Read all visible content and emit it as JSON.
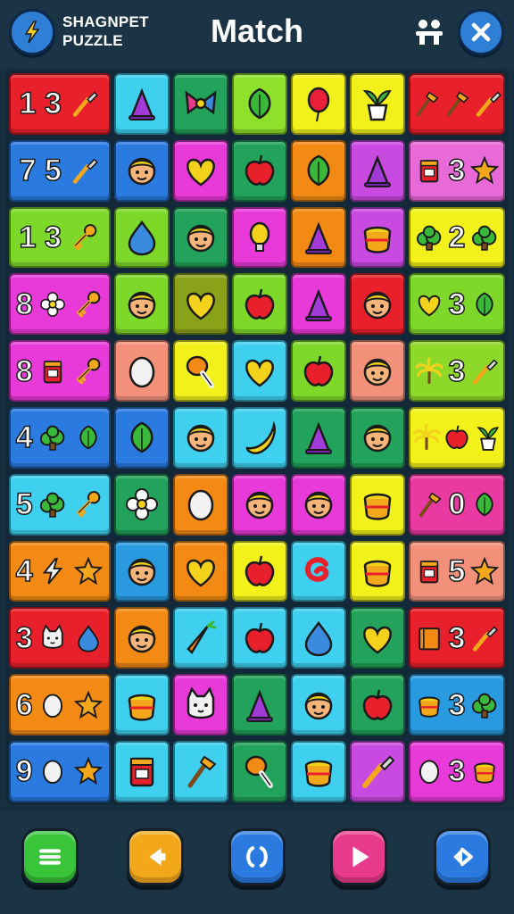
{
  "header": {
    "brand_line1": "SHAGNPET",
    "brand_line2": "PUZZLE",
    "title": "Match",
    "logo_icon": "lightning-emblem-icon",
    "people_icon": "people-icon",
    "close_icon": "close-icon"
  },
  "board": {
    "rows": [
      {
        "color": "#e8202c",
        "stack": [
          "1",
          "3"
        ],
        "stack_icons": [
          "brush-icon"
        ],
        "cells": [
          {
            "color": "#3fd0f0",
            "icon": "cone-icon"
          },
          {
            "color": "#22a25a",
            "icon": "bow-icon"
          },
          {
            "color": "#8ee02a",
            "icon": "leaf-icon"
          },
          {
            "color": "#f2f21a",
            "icon": "balloon-icon"
          },
          {
            "color": "#f2f21a",
            "icon": "plant-icon"
          }
        ],
        "last": {
          "color": "#e8202c",
          "icons": [
            "tools-icon",
            "tools-icon",
            "brush-icon"
          ]
        }
      },
      {
        "color": "#2a7ae0",
        "stack": [
          "7",
          "5"
        ],
        "stack_icons": [
          "brush-icon"
        ],
        "cells": [
          {
            "color": "#2a7ae0",
            "icon": "face-icon"
          },
          {
            "color": "#e83ad8",
            "icon": "heart-icon"
          },
          {
            "color": "#22a25a",
            "icon": "apple-icon"
          },
          {
            "color": "#f28a14",
            "icon": "leaf-icon"
          },
          {
            "color": "#c84ae0",
            "icon": "cone-icon"
          }
        ],
        "last": {
          "color": "#e86ad8",
          "num": "3",
          "icons": [
            "jar-icon",
            "star-icon"
          ]
        }
      },
      {
        "color": "#7ed82a",
        "stack": [
          "1",
          "3"
        ],
        "stack_icons": [
          "key-icon"
        ],
        "cells": [
          {
            "color": "#7ed82a",
            "icon": "drop-icon"
          },
          {
            "color": "#22a25a",
            "icon": "face-icon"
          },
          {
            "color": "#e83ad8",
            "icon": "bulb-icon"
          },
          {
            "color": "#f28a14",
            "icon": "cone-icon"
          },
          {
            "color": "#c84ae0",
            "icon": "pot-icon"
          }
        ],
        "last": {
          "color": "#f2f21a",
          "num": "2",
          "icons": [
            "bush-icon",
            "bush-icon"
          ]
        }
      },
      {
        "color": "#e83ad8",
        "stack": [
          "8"
        ],
        "stack_icons": [
          "flower-icon",
          "key-icon"
        ],
        "cells": [
          {
            "color": "#7ed82a",
            "icon": "face-icon"
          },
          {
            "color": "#8aa21a",
            "icon": "heart-icon"
          },
          {
            "color": "#7ed82a",
            "icon": "apple-icon"
          },
          {
            "color": "#e83ad8",
            "icon": "cone-icon"
          },
          {
            "color": "#e8202c",
            "icon": "face-icon"
          }
        ],
        "last": {
          "color": "#7ed82a",
          "num": "3",
          "icons": [
            "heart-icon",
            "leaf-icon"
          ]
        }
      },
      {
        "color": "#e83ad8",
        "stack": [
          "8"
        ],
        "stack_icons": [
          "jar-icon",
          "key-icon"
        ],
        "cells": [
          {
            "color": "#f2907a",
            "icon": "egg-icon"
          },
          {
            "color": "#f2f21a",
            "icon": "drumstick-icon"
          },
          {
            "color": "#3fd0f0",
            "icon": "heart-icon"
          },
          {
            "color": "#7ed82a",
            "icon": "apple-icon"
          },
          {
            "color": "#f2907a",
            "icon": "face-icon"
          }
        ],
        "last": {
          "color": "#8ed82a",
          "num": "3",
          "icons": [
            "palm-icon",
            "brush-icon"
          ]
        }
      },
      {
        "color": "#2a7ae0",
        "stack": [
          "4"
        ],
        "stack_icons": [
          "bush-icon",
          "leaf-icon"
        ],
        "cells": [
          {
            "color": "#2a7ae0",
            "icon": "leaf-icon"
          },
          {
            "color": "#3fd0f0",
            "icon": "face-icon"
          },
          {
            "color": "#3fd0f0",
            "icon": "banana-icon"
          },
          {
            "color": "#22a25a",
            "icon": "cone-icon"
          },
          {
            "color": "#22a25a",
            "icon": "face-icon"
          }
        ],
        "last": {
          "color": "#f2f21a",
          "icons": [
            "palm-icon",
            "apple-icon",
            "plant-icon"
          ]
        }
      },
      {
        "color": "#3fd0f0",
        "stack": [
          "5"
        ],
        "stack_icons": [
          "bush-icon",
          "key-icon"
        ],
        "cells": [
          {
            "color": "#22a25a",
            "icon": "flower-icon"
          },
          {
            "color": "#f28a14",
            "icon": "egg-icon"
          },
          {
            "color": "#e83ad8",
            "icon": "face-icon"
          },
          {
            "color": "#e83ad8",
            "icon": "face-icon"
          },
          {
            "color": "#f2f21a",
            "icon": "pot-icon"
          }
        ],
        "last": {
          "color": "#e83aa0",
          "num": "0",
          "icons": [
            "tools-icon",
            "leaf-icon"
          ]
        }
      },
      {
        "color": "#f28a14",
        "stack": [
          "4"
        ],
        "stack_icons": [
          "lightning-icon",
          "star-icon"
        ],
        "cells": [
          {
            "color": "#2a9ae0",
            "icon": "face-icon"
          },
          {
            "color": "#f28a14",
            "icon": "heart-icon"
          },
          {
            "color": "#f2f21a",
            "icon": "apple-icon"
          },
          {
            "color": "#3fd0f0",
            "icon": "swirl-icon"
          },
          {
            "color": "#f2f21a",
            "icon": "pot-icon"
          }
        ],
        "last": {
          "color": "#f2907a",
          "num": "5",
          "icons": [
            "jar-icon",
            "star-icon"
          ]
        }
      },
      {
        "color": "#e8202c",
        "stack": [
          "3"
        ],
        "stack_icons": [
          "cat-icon",
          "drop-icon"
        ],
        "cells": [
          {
            "color": "#f28a14",
            "icon": "face-icon"
          },
          {
            "color": "#3fd0f0",
            "icon": "carrot-icon"
          },
          {
            "color": "#3fd0f0",
            "icon": "apple-icon"
          },
          {
            "color": "#3fd0f0",
            "icon": "drop-icon"
          },
          {
            "color": "#22a25a",
            "icon": "heart-icon"
          }
        ],
        "last": {
          "color": "#e8202c",
          "num": "3",
          "icons": [
            "book-icon",
            "brush-icon"
          ]
        }
      },
      {
        "color": "#f28a14",
        "stack": [
          "6"
        ],
        "stack_icons": [
          "egg-icon",
          "star-icon"
        ],
        "cells": [
          {
            "color": "#3fd0f0",
            "icon": "pot-icon"
          },
          {
            "color": "#e83ad8",
            "icon": "cat-icon"
          },
          {
            "color": "#22a25a",
            "icon": "cone-icon"
          },
          {
            "color": "#3fd0f0",
            "icon": "face-icon"
          },
          {
            "color": "#22a25a",
            "icon": "apple-icon"
          }
        ],
        "last": {
          "color": "#2a9ae0",
          "num": "3",
          "icons": [
            "pot-icon",
            "bush-icon"
          ]
        }
      },
      {
        "color": "#2a7ae0",
        "stack": [
          "9"
        ],
        "stack_icons": [
          "egg-icon",
          "star-icon"
        ],
        "cells": [
          {
            "color": "#3fd0f0",
            "icon": "jar-icon"
          },
          {
            "color": "#3fd0f0",
            "icon": "tools-icon"
          },
          {
            "color": "#22a25a",
            "icon": "drumstick-icon"
          },
          {
            "color": "#3fd0f0",
            "icon": "pot-icon"
          },
          {
            "color": "#c84ae0",
            "icon": "brush-icon"
          }
        ],
        "last": {
          "color": "#e83ad8",
          "num": "3",
          "icons": [
            "egg-icon",
            "pot-icon"
          ]
        }
      }
    ]
  },
  "footer": {
    "buttons": [
      {
        "name": "menu-button",
        "icon": "menu-icon",
        "color": "#3ac43a"
      },
      {
        "name": "back-button",
        "icon": "back-arrow-icon",
        "color": "#f2a81a"
      },
      {
        "name": "restart-button",
        "icon": "refresh-icon",
        "color": "#2a7ae0"
      },
      {
        "name": "play-button",
        "icon": "play-icon",
        "color": "#e83a8a"
      },
      {
        "name": "next-button",
        "icon": "forward-icon",
        "color": "#2a7ae0"
      }
    ]
  }
}
